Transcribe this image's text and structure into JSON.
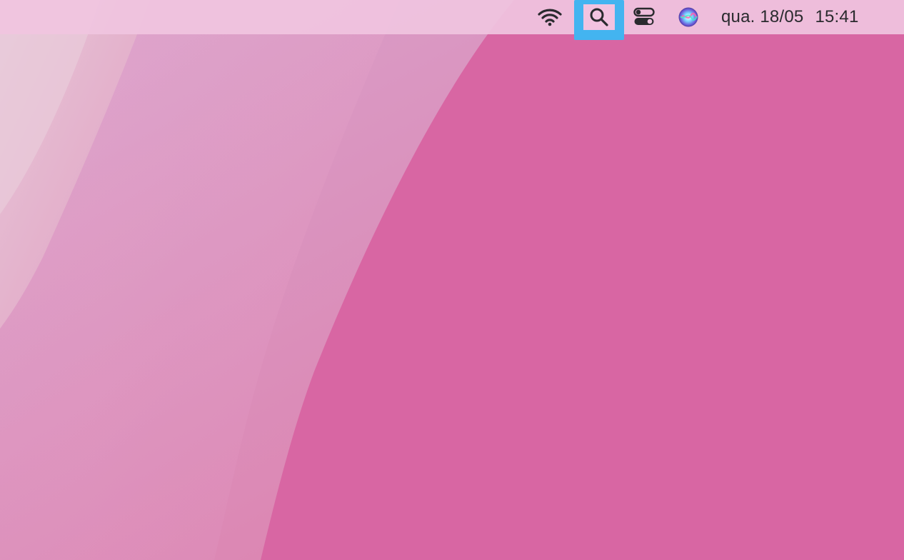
{
  "menubar": {
    "status_icons": [
      {
        "name": "wifi-icon"
      },
      {
        "name": "spotlight-search-icon",
        "highlighted": true
      },
      {
        "name": "control-center-icon"
      },
      {
        "name": "siri-icon"
      }
    ],
    "date": "qua. 18/05",
    "time": "15:41"
  },
  "colors": {
    "menubar_bg": "#f0c4e0",
    "highlight": "#43b4f0",
    "wallpaper_main": "#d866a3",
    "wallpaper_light": "#e6c4d6",
    "icon": "#2a2a2e"
  }
}
